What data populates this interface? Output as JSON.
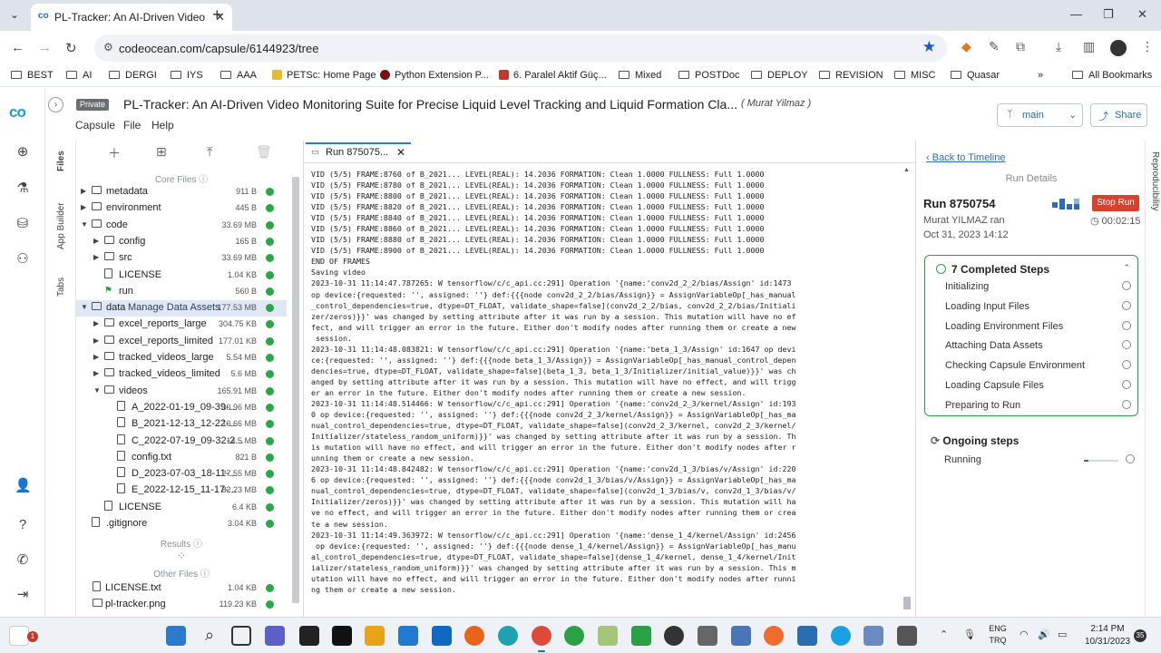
{
  "browser": {
    "tab_title": "PL-Tracker: An AI-Driven Video",
    "url": "codeocean.com/capsule/6144923/tree",
    "bookmarks": [
      {
        "label": "BEST",
        "icon": "folder-icon"
      },
      {
        "label": "AI",
        "icon": "folder-icon"
      },
      {
        "label": "DERGI",
        "icon": "folder-icon"
      },
      {
        "label": "IYS",
        "icon": "folder-icon"
      },
      {
        "label": "AAA",
        "icon": "folder-icon"
      },
      {
        "label": "PETSc: Home Page",
        "icon": "petsc-icon"
      },
      {
        "label": "Python Extension P...",
        "icon": "python-icon"
      },
      {
        "label": "6. Paralel Aktif Güç...",
        "icon": "pdf-icon"
      },
      {
        "label": "Mixed",
        "icon": "folder-icon"
      },
      {
        "label": "POSTDoc",
        "icon": "folder-icon"
      },
      {
        "label": "DEPLOY",
        "icon": "folder-icon"
      },
      {
        "label": "REVISION",
        "icon": "folder-icon"
      },
      {
        "label": "MISC",
        "icon": "folder-icon"
      },
      {
        "label": "Quasar",
        "icon": "folder-icon"
      }
    ],
    "all_bookmarks": "All Bookmarks"
  },
  "app": {
    "private_badge": "Private",
    "capsule_title": "PL-Tracker: An AI-Driven Video Monitoring Suite for Precise Liquid Level Tracking and Liquid Formation Cla...",
    "author": "( Murat Yilmaz )",
    "menu": [
      "Capsule",
      "File",
      "Help"
    ],
    "branch": "main",
    "share": "Share"
  },
  "side_tabs": [
    "Files",
    "App Builder",
    "Tabs"
  ],
  "files": {
    "core_files": "Core Files",
    "results": "Results",
    "other_files": "Other Files",
    "rows": [
      {
        "name": "metadata",
        "size": "911 B",
        "level": 0,
        "type": "folder",
        "caret": "right"
      },
      {
        "name": "environment",
        "size": "445 B",
        "level": 0,
        "type": "folder",
        "caret": "right"
      },
      {
        "name": "code",
        "size": "33.69 MB",
        "level": 0,
        "type": "folder",
        "caret": "down"
      },
      {
        "name": "config",
        "size": "165 B",
        "level": 1,
        "type": "folder",
        "caret": "right"
      },
      {
        "name": "src",
        "size": "33.69 MB",
        "level": 1,
        "type": "folder",
        "caret": "right"
      },
      {
        "name": "LICENSE",
        "size": "1.04 KB",
        "level": 1,
        "type": "doc",
        "caret": ""
      },
      {
        "name": "run",
        "size": "560 B",
        "level": 1,
        "type": "run",
        "caret": ""
      },
      {
        "name": "data",
        "size": "177.53 MB",
        "level": 0,
        "type": "folder",
        "caret": "down",
        "extra": "Manage Data Assets"
      },
      {
        "name": "excel_reports_large",
        "size": "304.75 KB",
        "level": 1,
        "type": "folder",
        "caret": "right"
      },
      {
        "name": "excel_reports_limited",
        "size": "177.01 KB",
        "level": 1,
        "type": "folder",
        "caret": "right"
      },
      {
        "name": "tracked_videos_large",
        "size": "5.54 MB",
        "level": 1,
        "type": "folder",
        "caret": "right"
      },
      {
        "name": "tracked_videos_limited",
        "size": "5.6 MB",
        "level": 1,
        "type": "folder",
        "caret": "right"
      },
      {
        "name": "videos",
        "size": "165.91 MB",
        "level": 1,
        "type": "folder",
        "caret": "down"
      },
      {
        "name": "A_2022-01-19_09-39-...",
        "size": "30.96 MB",
        "level": 2,
        "type": "doc",
        "caret": ""
      },
      {
        "name": "B_2021-12-13_12-22-...",
        "size": "10.66 MB",
        "level": 2,
        "type": "doc",
        "caret": ""
      },
      {
        "name": "C_2022-07-19_09-32-2...",
        "size": "14.5 MB",
        "level": 2,
        "type": "doc",
        "caret": ""
      },
      {
        "name": "config.txt",
        "size": "821 B",
        "level": 2,
        "type": "doc",
        "caret": ""
      },
      {
        "name": "D_2023-07-03_18-11-...",
        "size": "27.55 MB",
        "level": 2,
        "type": "doc",
        "caret": ""
      },
      {
        "name": "E_2022-12-15_11-17-...",
        "size": "82.23 MB",
        "level": 2,
        "type": "doc",
        "caret": ""
      },
      {
        "name": "LICENSE",
        "size": "6.4 KB",
        "level": 1,
        "type": "doc",
        "caret": ""
      },
      {
        "name": ".gitignore",
        "size": "3.04 KB",
        "level": 0,
        "type": "doc",
        "caret": ""
      }
    ],
    "other_rows": [
      {
        "name": "LICENSE.txt",
        "size": "1.04 KB",
        "type": "doc"
      },
      {
        "name": "pl-tracker.png",
        "size": "119.23 KB",
        "type": "image"
      }
    ]
  },
  "log": {
    "tab_label": "Run 875075...",
    "lines": [
      "VID (5/5) FRAME:8760 of B_2021... LEVEL(REAL): 14.2036 FORMATION: Clean 1.0000 FULLNESS: Full 1.0000",
      "VID (5/5) FRAME:8780 of B_2021... LEVEL(REAL): 14.2036 FORMATION: Clean 1.0000 FULLNESS: Full 1.0000",
      "VID (5/5) FRAME:8800 of B_2021... LEVEL(REAL): 14.2036 FORMATION: Clean 1.0000 FULLNESS: Full 1.0000",
      "VID (5/5) FRAME:8820 of B_2021... LEVEL(REAL): 14.2036 FORMATION: Clean 1.0000 FULLNESS: Full 1.0000",
      "VID (5/5) FRAME:8840 of B_2021... LEVEL(REAL): 14.2036 FORMATION: Clean 1.0000 FULLNESS: Full 1.0000",
      "VID (5/5) FRAME:8860 of B_2021... LEVEL(REAL): 14.2036 FORMATION: Clean 1.0000 FULLNESS: Full 1.0000",
      "VID (5/5) FRAME:8880 of B_2021... LEVEL(REAL): 14.2036 FORMATION: Clean 1.0000 FULLNESS: Full 1.0000",
      "VID (5/5) FRAME:8900 of B_2021... LEVEL(REAL): 14.2036 FORMATION: Clean 1.0000 FULLNESS: Full 1.0000",
      "END OF FRAMES",
      "Saving video",
      "2023-10-31 11:14:47.787265: W tensorflow/c/c_api.cc:291] Operation '{name:'conv2d_2_2/bias/Assign' id:1473",
      "op device:{requested: '', assigned: ''} def:{{{node conv2d_2_2/bias/Assign}} = AssignVariableOp[_has_manual",
      "_control_dependencies=true, dtype=DT_FLOAT, validate_shape=false](conv2d_2_2/bias, conv2d_2_2/bias/Initiali",
      "zer/zeros)}}' was changed by setting attribute after it was run by a session. This mutation will have no ef",
      "fect, and will trigger an error in the future. Either don't modify nodes after running them or create a new",
      " session.",
      "2023-10-31 11:14:48.083821: W tensorflow/c/c_api.cc:291] Operation '{name:'beta_1_3/Assign' id:1647 op devi",
      "ce:{requested: '', assigned: ''} def:{{{node beta_1_3/Assign}} = AssignVariableOp[_has_manual_control_depen",
      "dencies=true, dtype=DT_FLOAT, validate_shape=false](beta_1_3, beta_1_3/Initializer/initial_value)}}' was ch",
      "anged by setting attribute after it was run by a session. This mutation will have no effect, and will trigg",
      "er an error in the future. Either don't modify nodes after running them or create a new session.",
      "2023-10-31 11:14:48.514466: W tensorflow/c/c_api.cc:291] Operation '{name:'conv2d_2_3/kernel/Assign' id:193",
      "0 op device:{requested: '', assigned: ''} def:{{{node conv2d_2_3/kernel/Assign}} = AssignVariableOp[_has_ma",
      "nual_control_dependencies=true, dtype=DT_FLOAT, validate_shape=false](conv2d_2_3/kernel, conv2d_2_3/kernel/",
      "Initializer/stateless_random_uniform)}}' was changed by setting attribute after it was run by a session. Th",
      "is mutation will have no effect, and will trigger an error in the future. Either don't modify nodes after r",
      "unning them or create a new session.",
      "2023-10-31 11:14:48.842482: W tensorflow/c/c_api.cc:291] Operation '{name:'conv2d_1_3/bias/v/Assign' id:220",
      "6 op device:{requested: '', assigned: ''} def:{{{node conv2d_1_3/bias/v/Assign}} = AssignVariableOp[_has_ma",
      "nual_control_dependencies=true, dtype=DT_FLOAT, validate_shape=false](conv2d_1_3/bias/v, conv2d_1_3/bias/v/",
      "Initializer/zeros)}}' was changed by setting attribute after it was run by a session. This mutation will ha",
      "ve no effect, and will trigger an error in the future. Either don't modify nodes after running them or crea",
      "te a new session.",
      "2023-10-31 11:14:49.363972: W tensorflow/c/c_api.cc:291] Operation '{name:'dense_1_4/kernel/Assign' id:2456",
      " op device:{requested: '', assigned: ''} def:{{{node dense_1_4/kernel/Assign}} = AssignVariableOp[_has_manu",
      "al_control_dependencies=true, dtype=DT_FLOAT, validate_shape=false](dense_1_4/kernel, dense_1_4/kernel/Init",
      "ializer/stateless_random_uniform)}}' was changed by setting attribute after it was run by a session. This m",
      "utation will have no effect, and will trigger an error in the future. Either don't modify nodes after runni",
      "ng them or create a new session."
    ]
  },
  "run": {
    "back": "Back to Timeline",
    "heading": "Run Details",
    "id": "Run 8750754",
    "stop": "Stop Run",
    "ran_by": "Murat YILMAZ ran",
    "duration": "00:02:15",
    "date": "Oct 31, 2023 14:12",
    "completed_heading": "7 Completed Steps",
    "steps": [
      "Initializing",
      "Loading Input Files",
      "Loading Environment Files",
      "Attaching Data Assets",
      "Checking Capsule Environment",
      "Loading Capsule Files",
      "Preparing to Run"
    ],
    "ongoing_heading": "Ongoing steps",
    "ongoing": "Running",
    "repro_tab": "Reproducibility"
  },
  "taskbar": {
    "lang": "ENG",
    "lang2": "TRQ",
    "time": "2:14 PM",
    "date": "10/31/2023",
    "notifications": "35",
    "badge": "1"
  },
  "colors": {
    "accent": "#2a6db3",
    "ok": "#28a745",
    "stop": "#d9412f",
    "steps_border": "#2aa146"
  }
}
